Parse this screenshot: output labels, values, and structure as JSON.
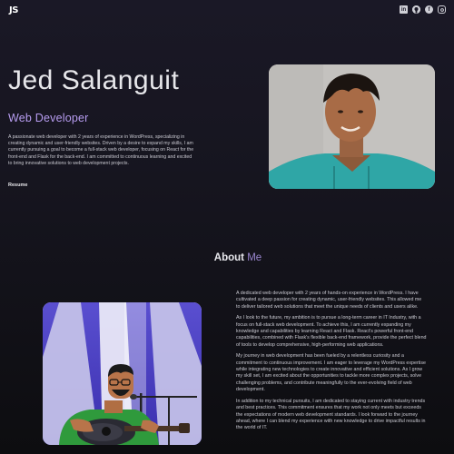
{
  "header": {
    "logo": "JS",
    "socials": [
      {
        "icon": "linkedin-icon",
        "glyph": "in"
      },
      {
        "icon": "github-icon",
        "glyph": ""
      },
      {
        "icon": "facebook-icon",
        "glyph": "f"
      },
      {
        "icon": "instagram-icon",
        "glyph": ""
      }
    ]
  },
  "hero": {
    "name": "Jed Salanguit",
    "role": "Web Developer",
    "description": "A passionate web developer with 2 years of experience in WordPress, specializing in creating dynamic and user-friendly websites. Driven by a desire to expand my skills, I am currently pursuing a goal to become a full-stack web developer, focusing on React for the front-end and Flask for the back-end. I am committed to continuous learning and excited to bring innovative solutions to web development projects.",
    "resume_label": "Resume"
  },
  "about": {
    "title_main": "About",
    "title_accent": "Me",
    "paragraphs": [
      "A dedicated web developer with 2 years of hands-on experience in WordPress. I have cultivated a deep passion for creating dynamic, user-friendly websites. This allowed me to deliver tailored web solutions that meet the unique needs of clients and users alike.",
      "As I look to the future, my ambition is to pursue a long-term career in IT Industry, with a focus on full-stack web development. To achieve this, I am currently expanding my knowledge and capabilities by learning React and Flask. React's powerful front-end capabilities, combined with Flask's flexible back-end framework, provide the perfect blend of tools to develop comprehensive, high-performing web applications.",
      "My journey in web development has been fueled by a relentless curiosity and a commitment to continuous improvement. I am eager to leverage my WordPress expertise while integrating new technologies to create innovative and efficient solutions. As I grow my skill set, I am excited about the opportunities to tackle more complex projects, solve challenging problems, and contribute meaningfully to the ever-evolving field of web development.",
      "In addition to my technical pursuits, I am dedicated to staying current with industry trends and best practices. This commitment ensures that my work not only meets but exceeds the expectations of modern web development standards. I look forward to the journey ahead, where I can blend my experience with new knowledge to drive impactful results in the world of IT."
    ]
  },
  "colors": {
    "accent": "#b79cf0",
    "background": "#16151f",
    "shirt": "#2fa6a6",
    "guitar_shirt": "#2f9a3c"
  }
}
